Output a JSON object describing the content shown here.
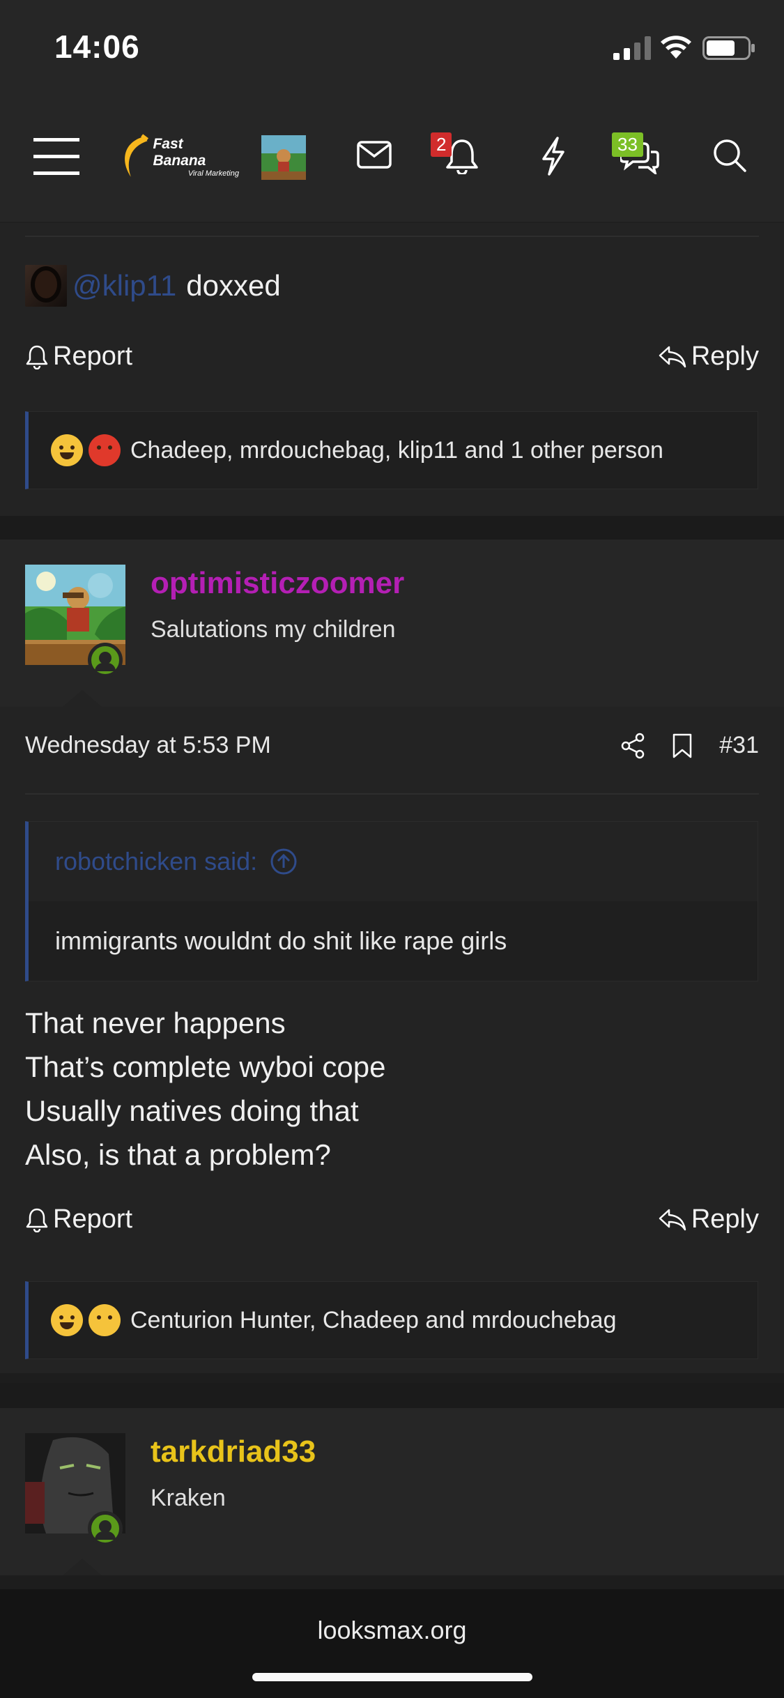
{
  "status_bar": {
    "time": "14:06"
  },
  "nav": {
    "logo_text": "Fast Banana",
    "logo_subtext": "Viral Marketing",
    "alerts_badge": "2",
    "conversations_badge": "33"
  },
  "post_prev": {
    "mention": "@klip11",
    "mention_rest": "doxxed",
    "report_label": "Report",
    "reply_label": "Reply",
    "reactions_text": "Chadeep, mrdouchebag, klip11 and 1 other person"
  },
  "post_31": {
    "username": "optimisticzoomer",
    "user_title": "Salutations my children",
    "date": "Wednesday at 5:53 PM",
    "post_number": "#31",
    "quote_author": "robotchicken said:",
    "quote_text": "immigrants wouldnt do shit like rape girls",
    "lines": [
      "That never happens",
      "That’s complete wyboi cope",
      "Usually natives doing that",
      "Also, is that a problem?"
    ],
    "report_label": "Report",
    "reply_label": "Reply",
    "reactions_text": "Centurion Hunter, Chadeep and mrdouchebag"
  },
  "post_next": {
    "username": "tarkdriad33",
    "user_title": "Kraken"
  },
  "footer": {
    "url": "looksmax.org"
  },
  "colors": {
    "link": "#2f4b8a",
    "username_purple": "#b41fb4",
    "username_yellow": "#e8c31a",
    "online": "#5a9a1a"
  }
}
